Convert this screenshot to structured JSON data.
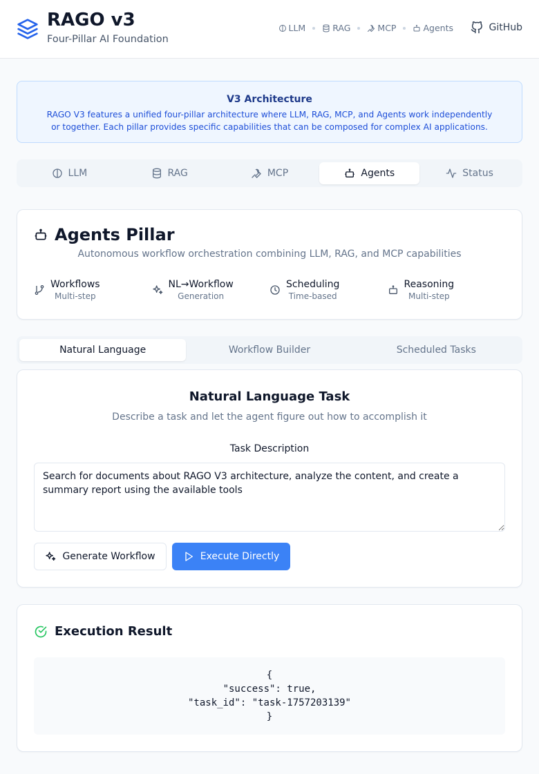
{
  "header": {
    "title": "RAGO v3",
    "subtitle": "Four-Pillar AI Foundation",
    "nav": [
      {
        "label": "LLM",
        "icon": "brain-icon"
      },
      {
        "label": "RAG",
        "icon": "database-icon"
      },
      {
        "label": "MCP",
        "icon": "wrench-icon"
      },
      {
        "label": "Agents",
        "icon": "bot-icon"
      }
    ],
    "github_label": "GitHub"
  },
  "banner": {
    "title": "V3 Architecture",
    "text": "RAGO V3 features a unified four-pillar architecture where LLM, RAG, MCP, and Agents work independently or together. Each pillar provides specific capabilities that can be composed for complex AI applications."
  },
  "pillar_tabs": [
    {
      "label": "LLM",
      "icon": "brain-icon",
      "active": false
    },
    {
      "label": "RAG",
      "icon": "database-icon",
      "active": false
    },
    {
      "label": "MCP",
      "icon": "wrench-icon",
      "active": false
    },
    {
      "label": "Agents",
      "icon": "bot-icon",
      "active": true
    },
    {
      "label": "Status",
      "icon": "activity-icon",
      "active": false
    }
  ],
  "pillar": {
    "title": "Agents Pillar",
    "description": "Autonomous workflow orchestration combining LLM, RAG, and MCP capabilities",
    "features": [
      {
        "name": "Workflows",
        "sub": "Multi-step",
        "icon": "git-branch-icon"
      },
      {
        "name": "NL→Workflow",
        "sub": "Generation",
        "icon": "sparkles-icon"
      },
      {
        "name": "Scheduling",
        "sub": "Time-based",
        "icon": "clock-icon"
      },
      {
        "name": "Reasoning",
        "sub": "Multi-step",
        "icon": "bot-icon"
      }
    ]
  },
  "sub_tabs": [
    {
      "label": "Natural Language",
      "active": true
    },
    {
      "label": "Workflow Builder",
      "active": false
    },
    {
      "label": "Scheduled Tasks",
      "active": false
    }
  ],
  "task": {
    "title": "Natural Language Task",
    "subtitle": "Describe a task and let the agent figure out how to accomplish it",
    "field_label": "Task Description",
    "value": "Search for documents about RAGO V3 architecture, analyze the content, and create a summary report using the available tools",
    "generate_label": "Generate Workflow",
    "execute_label": "Execute Directly"
  },
  "result": {
    "title": "Execution Result",
    "lines": [
      "{",
      "\"success\": true,",
      "\"task_id\": \"task-1757203139\"",
      "}"
    ]
  },
  "colors": {
    "primary": "#3b82f6",
    "success": "#22c55e",
    "banner_bg": "#eff6ff",
    "banner_text": "#1d4ed8"
  }
}
